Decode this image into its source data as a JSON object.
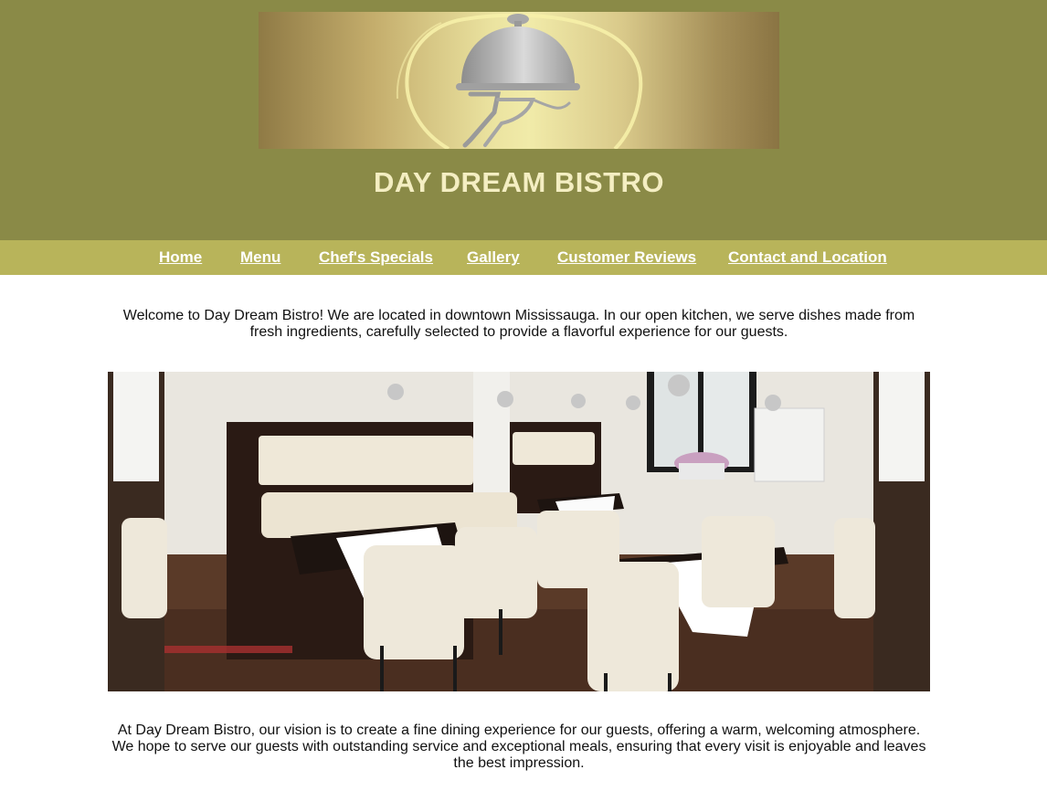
{
  "header": {
    "title": "DAY DREAM BISTRO",
    "logo_icon": "serving-cloche-icon",
    "background_color": "#8a8a47",
    "title_color": "#f4eec2"
  },
  "nav": {
    "background_color": "#b8b45a",
    "items": [
      {
        "label": "Home"
      },
      {
        "label": "Menu"
      },
      {
        "label": "Chef's Specials"
      },
      {
        "label": "Gallery"
      },
      {
        "label": "Customer Reviews"
      },
      {
        "label": "Contact and Location"
      }
    ]
  },
  "main": {
    "intro": "Welcome to Day Dream Bistro! We are located in downtown Mississauga. In our open kitchen, we serve dishes made from fresh ingredients, carefully selected to provide a flavorful experience for our guests.",
    "vision": "At Day Dream Bistro, our vision is to create a fine dining experience for our guests, offering a warm, welcoming atmosphere. We hope to serve our guests with outstanding service and exceptional meals, ensuring that every visit is enjoyable and leaves the best impression."
  }
}
